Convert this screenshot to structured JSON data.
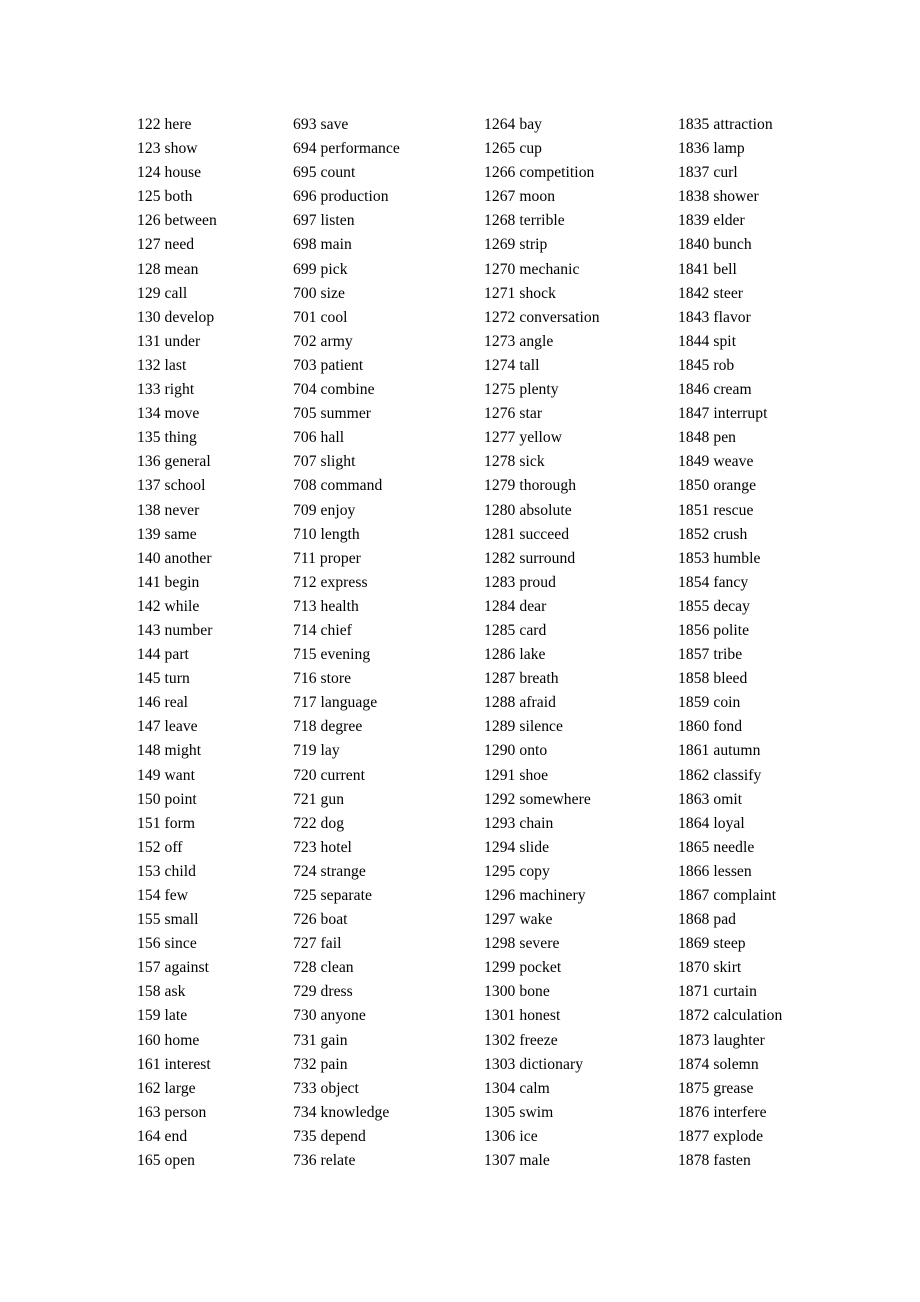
{
  "document": {
    "type": "vocabulary-word-list",
    "page_background": "#ffffff",
    "text_color": "#000000",
    "columns": [
      {
        "index": 0,
        "entries": [
          {
            "number": "122",
            "word": "here"
          },
          {
            "number": "123",
            "word": "show"
          },
          {
            "number": "124",
            "word": "house"
          },
          {
            "number": "125",
            "word": "both"
          },
          {
            "number": "126",
            "word": "between"
          },
          {
            "number": "127",
            "word": "need"
          },
          {
            "number": "128",
            "word": "mean"
          },
          {
            "number": "129",
            "word": "call"
          },
          {
            "number": "130",
            "word": "develop"
          },
          {
            "number": "131",
            "word": "under"
          },
          {
            "number": "132",
            "word": "last"
          },
          {
            "number": "133",
            "word": "right"
          },
          {
            "number": "134",
            "word": "move"
          },
          {
            "number": "135",
            "word": "thing"
          },
          {
            "number": "136",
            "word": "general"
          },
          {
            "number": "137",
            "word": "school"
          },
          {
            "number": "138",
            "word": "never"
          },
          {
            "number": "139",
            "word": "same"
          },
          {
            "number": "140",
            "word": "another"
          },
          {
            "number": "141",
            "word": "begin"
          },
          {
            "number": "142",
            "word": "while"
          },
          {
            "number": "143",
            "word": "number"
          },
          {
            "number": "144",
            "word": "part"
          },
          {
            "number": "145",
            "word": "turn"
          },
          {
            "number": "146",
            "word": "real"
          },
          {
            "number": "147",
            "word": "leave"
          },
          {
            "number": "148",
            "word": "might"
          },
          {
            "number": "149",
            "word": "want"
          },
          {
            "number": "150",
            "word": "point"
          },
          {
            "number": "151",
            "word": "form"
          },
          {
            "number": "152",
            "word": "off"
          },
          {
            "number": "153",
            "word": "child"
          },
          {
            "number": "154",
            "word": "few"
          },
          {
            "number": "155",
            "word": "small"
          },
          {
            "number": "156",
            "word": "since"
          },
          {
            "number": "157",
            "word": "against"
          },
          {
            "number": "158",
            "word": "ask"
          },
          {
            "number": "159",
            "word": "late"
          },
          {
            "number": "160",
            "word": "home"
          },
          {
            "number": "161",
            "word": "interest"
          },
          {
            "number": "162",
            "word": "large"
          },
          {
            "number": "163",
            "word": "person"
          },
          {
            "number": "164",
            "word": "end"
          },
          {
            "number": "165",
            "word": "open"
          }
        ]
      },
      {
        "index": 1,
        "entries": [
          {
            "number": "693",
            "word": "save"
          },
          {
            "number": "694",
            "word": "performance"
          },
          {
            "number": "695",
            "word": "count"
          },
          {
            "number": "696",
            "word": "production"
          },
          {
            "number": "697",
            "word": "listen"
          },
          {
            "number": "698",
            "word": "main"
          },
          {
            "number": "699",
            "word": "pick"
          },
          {
            "number": "700",
            "word": "size"
          },
          {
            "number": "701",
            "word": "cool"
          },
          {
            "number": "702",
            "word": "army"
          },
          {
            "number": "703",
            "word": "patient"
          },
          {
            "number": "704",
            "word": "combine"
          },
          {
            "number": "705",
            "word": "summer"
          },
          {
            "number": "706",
            "word": "hall"
          },
          {
            "number": "707",
            "word": "slight"
          },
          {
            "number": "708",
            "word": "command"
          },
          {
            "number": "709",
            "word": "enjoy"
          },
          {
            "number": "710",
            "word": "length"
          },
          {
            "number": "711",
            "word": "proper"
          },
          {
            "number": "712",
            "word": "express"
          },
          {
            "number": "713",
            "word": "health"
          },
          {
            "number": "714",
            "word": "chief"
          },
          {
            "number": "715",
            "word": "evening"
          },
          {
            "number": "716",
            "word": "store"
          },
          {
            "number": "717",
            "word": "language"
          },
          {
            "number": "718",
            "word": "degree"
          },
          {
            "number": "719",
            "word": "lay"
          },
          {
            "number": "720",
            "word": "current"
          },
          {
            "number": "721",
            "word": "gun"
          },
          {
            "number": "722",
            "word": "dog"
          },
          {
            "number": "723",
            "word": "hotel"
          },
          {
            "number": "724",
            "word": "strange"
          },
          {
            "number": "725",
            "word": "separate"
          },
          {
            "number": "726",
            "word": "boat"
          },
          {
            "number": "727",
            "word": "fail"
          },
          {
            "number": "728",
            "word": "clean"
          },
          {
            "number": "729",
            "word": "dress"
          },
          {
            "number": "730",
            "word": "anyone"
          },
          {
            "number": "731",
            "word": "gain"
          },
          {
            "number": "732",
            "word": "pain"
          },
          {
            "number": "733",
            "word": "object"
          },
          {
            "number": "734",
            "word": "knowledge"
          },
          {
            "number": "735",
            "word": "depend"
          },
          {
            "number": "736",
            "word": "relate"
          }
        ]
      },
      {
        "index": 2,
        "entries": [
          {
            "number": "1264",
            "word": "bay"
          },
          {
            "number": "1265",
            "word": "cup"
          },
          {
            "number": "1266",
            "word": "competition"
          },
          {
            "number": "1267",
            "word": "moon"
          },
          {
            "number": "1268",
            "word": "terrible"
          },
          {
            "number": "1269",
            "word": "strip"
          },
          {
            "number": "1270",
            "word": "mechanic"
          },
          {
            "number": "1271",
            "word": "shock"
          },
          {
            "number": "1272",
            "word": "conversation"
          },
          {
            "number": "1273",
            "word": "angle"
          },
          {
            "number": "1274",
            "word": "tall"
          },
          {
            "number": "1275",
            "word": "plenty"
          },
          {
            "number": "1276",
            "word": "star"
          },
          {
            "number": "1277",
            "word": "yellow"
          },
          {
            "number": "1278",
            "word": "sick"
          },
          {
            "number": "1279",
            "word": "thorough"
          },
          {
            "number": "1280",
            "word": "absolute"
          },
          {
            "number": "1281",
            "word": "succeed"
          },
          {
            "number": "1282",
            "word": "surround"
          },
          {
            "number": "1283",
            "word": "proud"
          },
          {
            "number": "1284",
            "word": "dear"
          },
          {
            "number": "1285",
            "word": "card"
          },
          {
            "number": "1286",
            "word": "lake"
          },
          {
            "number": "1287",
            "word": "breath"
          },
          {
            "number": "1288",
            "word": "afraid"
          },
          {
            "number": "1289",
            "word": "silence"
          },
          {
            "number": "1290",
            "word": "onto"
          },
          {
            "number": "1291",
            "word": "shoe"
          },
          {
            "number": "1292",
            "word": "somewhere"
          },
          {
            "number": "1293",
            "word": "chain"
          },
          {
            "number": "1294",
            "word": "slide"
          },
          {
            "number": "1295",
            "word": "copy"
          },
          {
            "number": "1296",
            "word": "machinery"
          },
          {
            "number": "1297",
            "word": "wake"
          },
          {
            "number": "1298",
            "word": "severe"
          },
          {
            "number": "1299",
            "word": "pocket"
          },
          {
            "number": "1300",
            "word": "bone"
          },
          {
            "number": "1301",
            "word": "honest"
          },
          {
            "number": "1302",
            "word": "freeze"
          },
          {
            "number": "1303",
            "word": "dictionary"
          },
          {
            "number": "1304",
            "word": "calm"
          },
          {
            "number": "1305",
            "word": "swim"
          },
          {
            "number": "1306",
            "word": "ice"
          },
          {
            "number": "1307",
            "word": "male"
          }
        ]
      },
      {
        "index": 3,
        "entries": [
          {
            "number": "1835",
            "word": "attraction"
          },
          {
            "number": "1836",
            "word": "lamp"
          },
          {
            "number": "1837",
            "word": "curl"
          },
          {
            "number": "1838",
            "word": "shower"
          },
          {
            "number": "1839",
            "word": "elder"
          },
          {
            "number": "1840",
            "word": "bunch"
          },
          {
            "number": "1841",
            "word": "bell"
          },
          {
            "number": "1842",
            "word": "steer"
          },
          {
            "number": "1843",
            "word": "flavor"
          },
          {
            "number": "1844",
            "word": "spit"
          },
          {
            "number": "1845",
            "word": "rob"
          },
          {
            "number": "1846",
            "word": "cream"
          },
          {
            "number": "1847",
            "word": "interrupt"
          },
          {
            "number": "1848",
            "word": "pen"
          },
          {
            "number": "1849",
            "word": "weave"
          },
          {
            "number": "1850",
            "word": "orange"
          },
          {
            "number": "1851",
            "word": "rescue"
          },
          {
            "number": "1852",
            "word": "crush"
          },
          {
            "number": "1853",
            "word": "humble"
          },
          {
            "number": "1854",
            "word": "fancy"
          },
          {
            "number": "1855",
            "word": "decay"
          },
          {
            "number": "1856",
            "word": "polite"
          },
          {
            "number": "1857",
            "word": "tribe"
          },
          {
            "number": "1858",
            "word": "bleed"
          },
          {
            "number": "1859",
            "word": "coin"
          },
          {
            "number": "1860",
            "word": "fond"
          },
          {
            "number": "1861",
            "word": "autumn"
          },
          {
            "number": "1862",
            "word": "classify"
          },
          {
            "number": "1863",
            "word": "omit"
          },
          {
            "number": "1864",
            "word": "loyal"
          },
          {
            "number": "1865",
            "word": "needle"
          },
          {
            "number": "1866",
            "word": "lessen"
          },
          {
            "number": "1867",
            "word": "complaint"
          },
          {
            "number": "1868",
            "word": "pad"
          },
          {
            "number": "1869",
            "word": "steep"
          },
          {
            "number": "1870",
            "word": "skirt"
          },
          {
            "number": "1871",
            "word": "curtain"
          },
          {
            "number": "1872",
            "word": "calculation"
          },
          {
            "number": "1873",
            "word": "laughter"
          },
          {
            "number": "1874",
            "word": "solemn"
          },
          {
            "number": "1875",
            "word": "grease"
          },
          {
            "number": "1876",
            "word": "interfere"
          },
          {
            "number": "1877",
            "word": "explode"
          },
          {
            "number": "1878",
            "word": "fasten"
          }
        ]
      }
    ]
  }
}
